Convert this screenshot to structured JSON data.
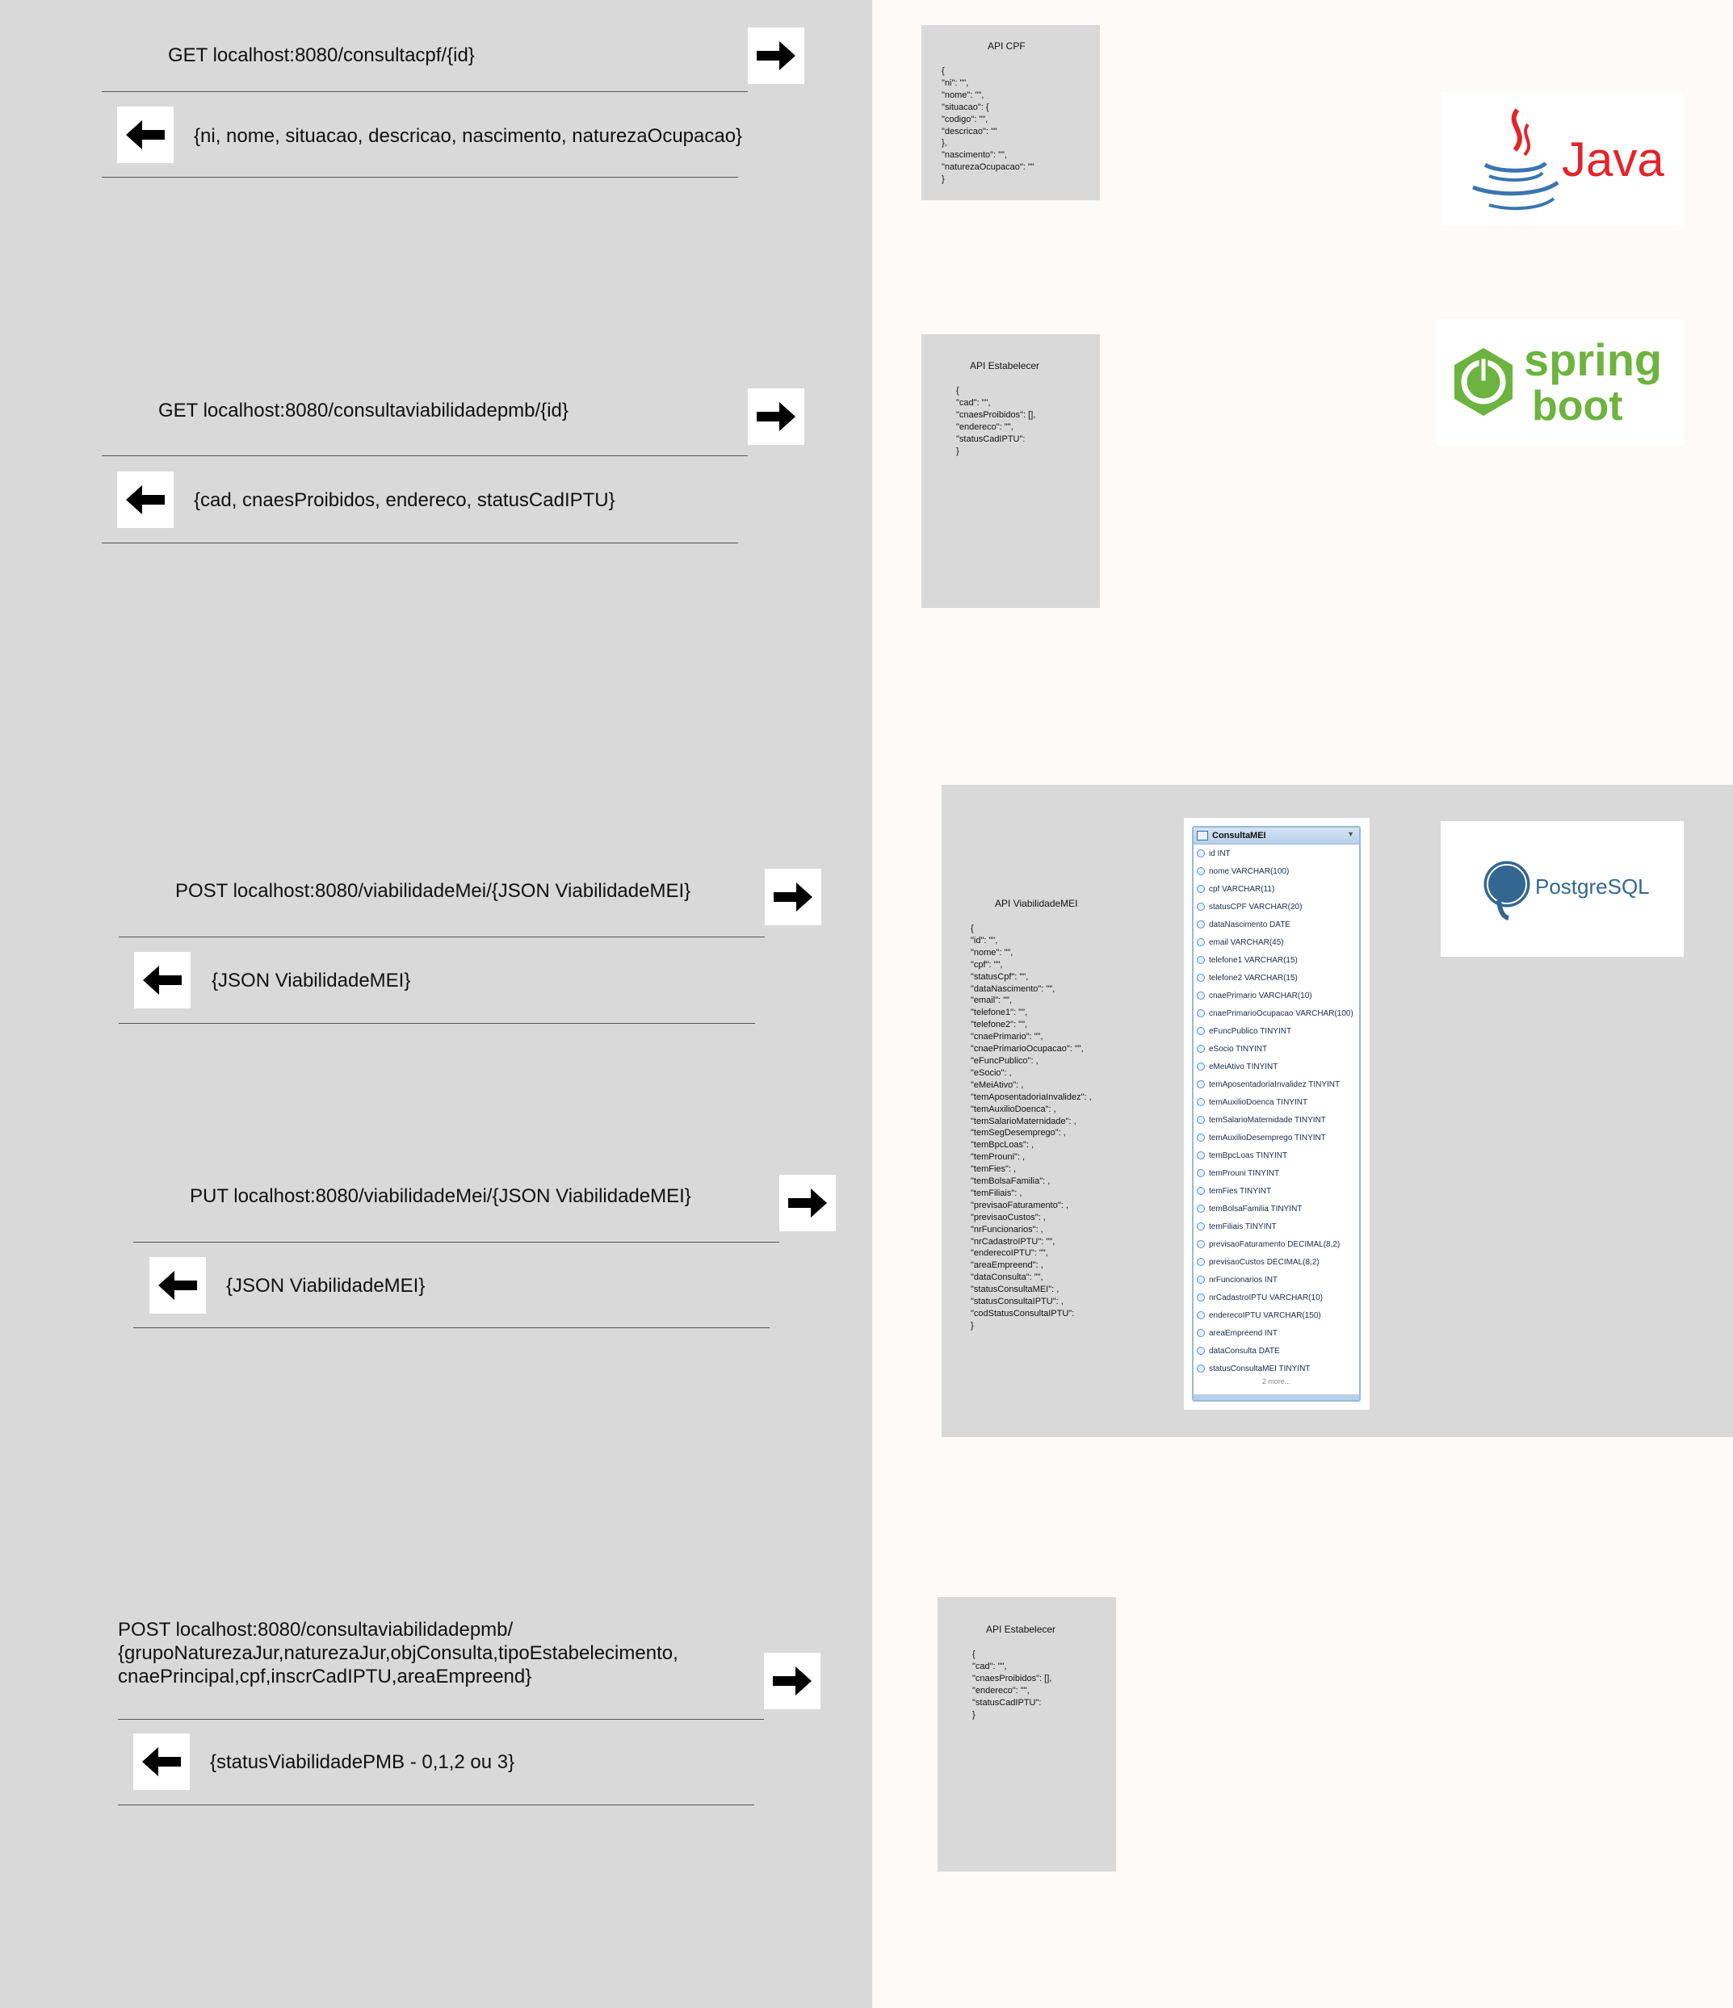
{
  "endpoints": [
    {
      "request": "GET localhost:8080/consultacpf/{id}",
      "response": "{ni, nome, situacao, descricao, nascimento, naturezaOcupacao}"
    },
    {
      "request": "GET localhost:8080/consultaviabilidadepmb/{id}",
      "response": "{cad, cnaesProibidos, endereco, statusCadIPTU}"
    },
    {
      "request": "POST localhost:8080/viabilidadeMei/{JSON ViabilidadeMEI}",
      "response": "{JSON ViabilidadeMEI}"
    },
    {
      "request": "PUT localhost:8080/viabilidadeMei/{JSON ViabilidadeMEI}",
      "response": "{JSON ViabilidadeMEI}"
    },
    {
      "request_lines": [
        "POST localhost:8080/consultaviabilidadepmb/",
        "{grupoNaturezaJur,naturezaJur,objConsulta,tipoEstabelecimento,",
        "cnaePrincipal,cpf,inscrCadIPTU,areaEmpreend}"
      ],
      "response": "{statusViabilidadePMB - 0,1,2 ou 3}"
    }
  ],
  "icons": {
    "request": "arrow-right-icon",
    "response": "arrow-left-icon"
  },
  "cards": {
    "cpf": {
      "title": "API CPF",
      "body": "{\n\"ni\": \"\",\n\"nome\": \"\",\n\"situacao\": {\n\"codigo\": \"\",\n\"descricao\": \"\"\n},\n\"nascimento\": \"\",\n\"naturezaOcupacao\": \"\"\n}"
    },
    "estabelecer1": {
      "title": "API Estabelecer",
      "body": "{\n\"cad\": \"\",\n\"cnaesProibidos\": [],\n\"endereco\": \"\",\n\"statusCadIPTU\":\n}"
    },
    "viabilidade": {
      "title": "API ViabilidadeMEI",
      "body": "{\n\"id\": \"\",\n\"nome\": \"\",\n\"cpf\": \"\",\n\"statusCpf\": \"\",\n\"dataNascimento\": \"\",\n\"email\": \"\",\n\"telefone1\": \"\",\n\"telefone2\": \"\",\n\"cnaePrimario\": \"\",\n\"cnaePrimarioOcupacao\": \"\",\n\"eFuncPublico\": ,\n\"eSocio\": ,\n\"eMeiAtivo\": ,\n\"temAposentadoriaInvalidez\": ,\n\"temAuxilioDoenca\": ,\n\"temSalarioMaternidade\": ,\n\"temSegDesemprego\": ,\n\"temBpcLoas\": ,\n\"temProuni\": ,\n\"temFies\": ,\n\"temBolsaFamilia\": ,\n\"temFiliais\": ,\n\"previsaoFaturamento\": ,\n\"previsaoCustos\": ,\n\"nrFuncionarios\": ,\n\"nrCadastroIPTU\": \"\",\n\"enderecoIPTU\": \"\",\n\"areaEmpreend\": ,\n\"dataConsulta\": \"\",\n\"statusConsultaMEI\": ,\n\"statusConsultaIPTU\": ,\n\"codStatusConsultaIPTU\":\n}"
    },
    "estabelecer2": {
      "title": "API Estabelecer",
      "body": "{\n\"cad\": \"\",\n\"cnaesProibidos\": [],\n\"endereco\": \"\",\n\"statusCadIPTU\":\n}"
    }
  },
  "erd": {
    "table_name": "ConsultaMEI",
    "columns": [
      "id INT",
      "nome VARCHAR(100)",
      "cpf VARCHAR(11)",
      "statusCPF VARCHAR(20)",
      "dataNascimento DATE",
      "email VARCHAR(45)",
      "telefone1 VARCHAR(15)",
      "telefone2 VARCHAR(15)",
      "cnaePrimario VARCHAR(10)",
      "cnaePrimarioOcupacao VARCHAR(100)",
      "eFuncPublico TINYINT",
      "eSocio TINYINT",
      "eMeiAtivo TINYINT",
      "temAposentadoriaInvalidez TINYINT",
      "temAuxilioDoenca TINYINT",
      "temSalarioMaternidade TINYINT",
      "temAuxilioDesemprego TINYINT",
      "temBpcLoas TINYINT",
      "temProuni TINYINT",
      "temFies TINYINT",
      "temBolsaFamilia TINYINT",
      "temFiliais TINYINT",
      "previsaoFaturamento DECIMAL(8,2)",
      "previsaoCustos DECIMAL(8,2)",
      "nrFuncionarios INT",
      "nrCadastroIPTU VARCHAR(10)",
      "enderecoIPTU VARCHAR(150)",
      "areaEmpreend INT",
      "dataConsulta DATE",
      "statusConsultaMEI TINYINT"
    ],
    "more": "2 more..."
  },
  "logos": {
    "java": {
      "text": "Java",
      "icon": "java-cup-icon",
      "color": "#e3242b"
    },
    "spring": {
      "line1": "spring",
      "line2": "boot",
      "icon": "spring-power-icon",
      "color": "#6db33f"
    },
    "postgres": {
      "text": "PostgreSQL",
      "icon": "postgres-elephant-icon",
      "color": "#336791"
    }
  }
}
